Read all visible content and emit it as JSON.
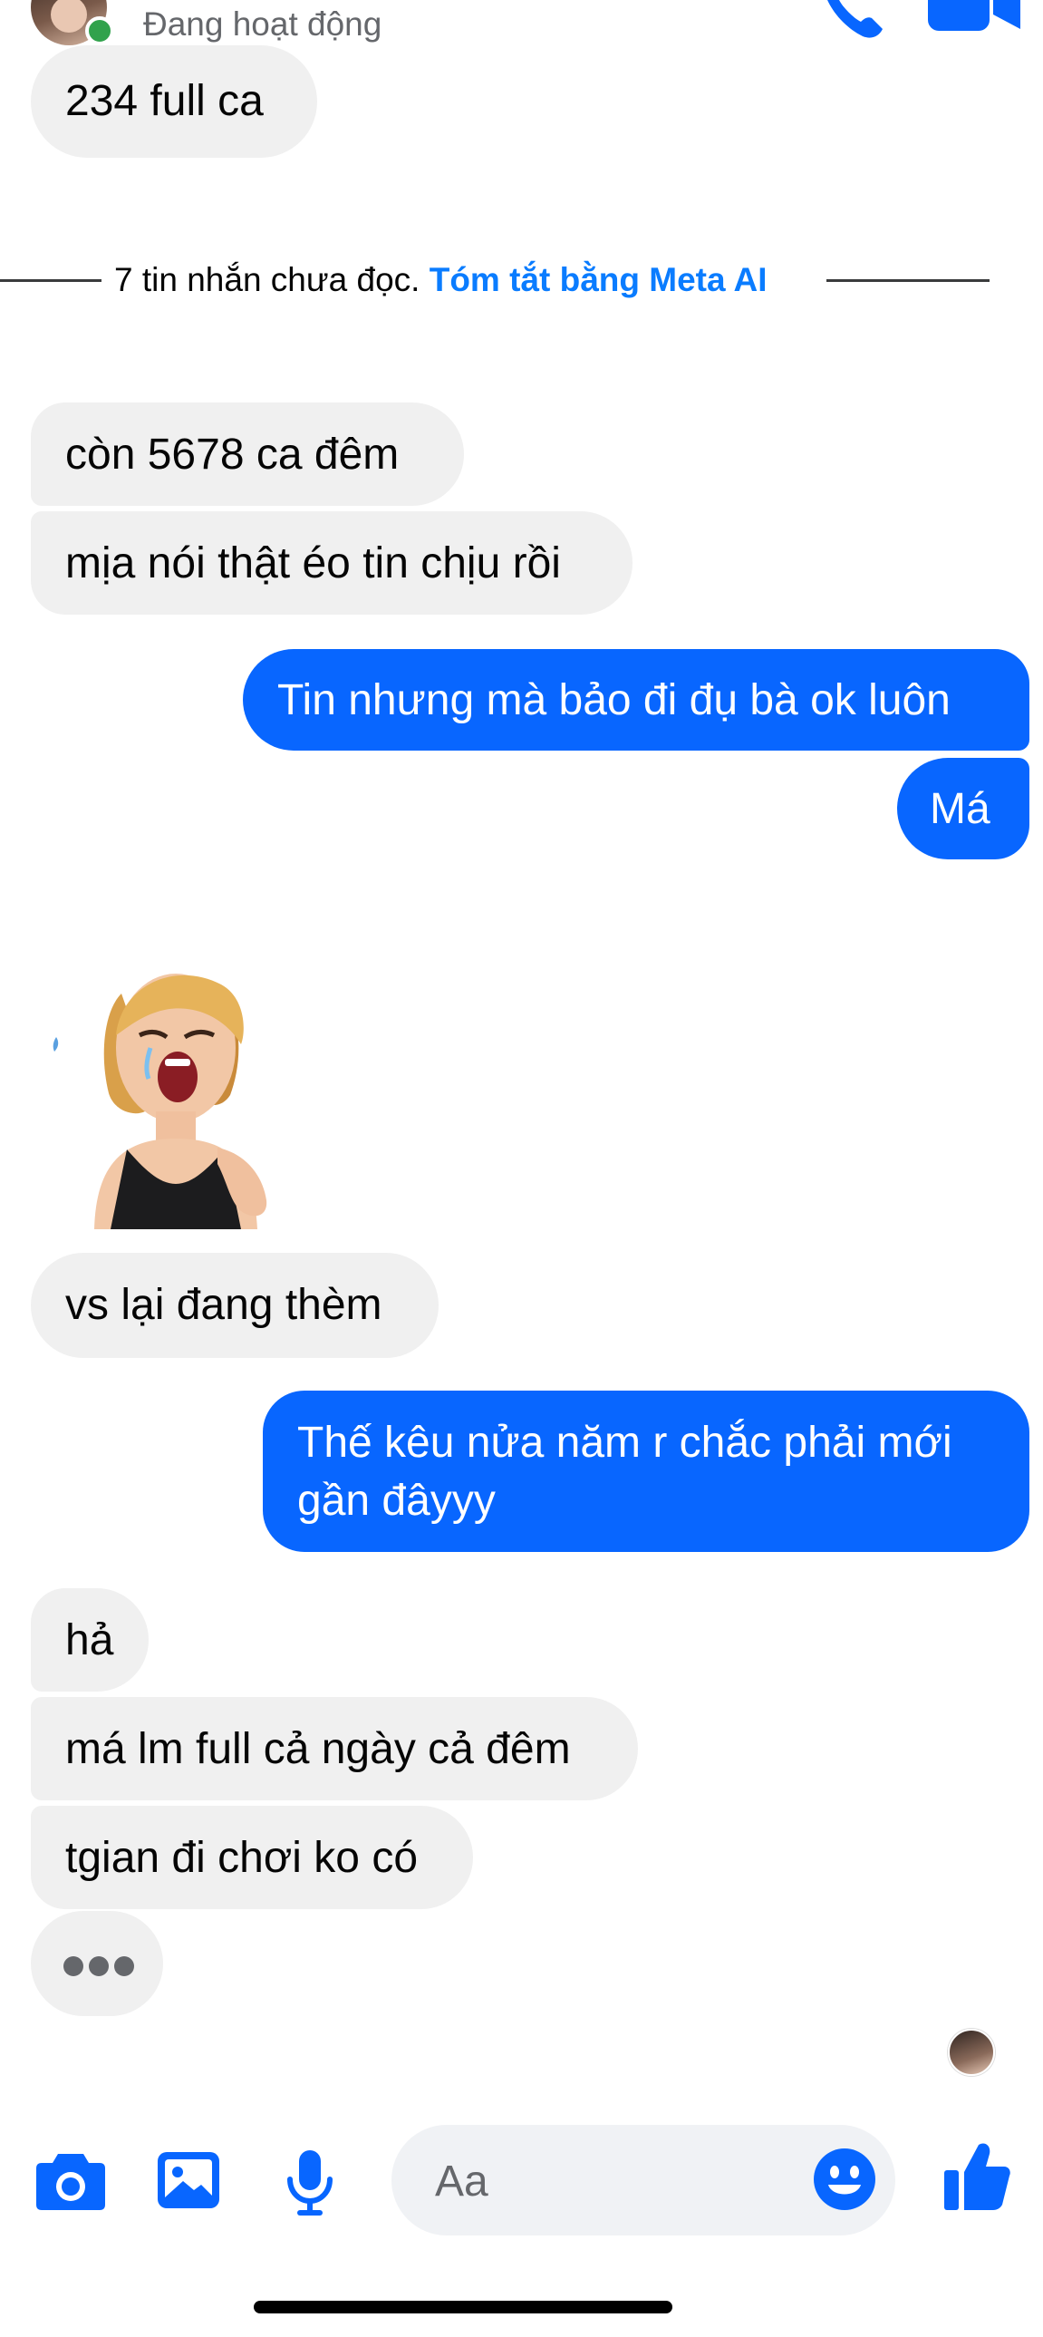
{
  "header": {
    "status": "Đang hoạt động"
  },
  "divider": {
    "unread_text": "7 tin nhắn chưa đọc.",
    "summary_link": "Tóm tắt bằng Meta AI"
  },
  "messages": [
    {
      "side": "in",
      "text": "234 full ca"
    },
    {
      "side": "in",
      "text": "còn 5678 ca đêm"
    },
    {
      "side": "in",
      "text": "mịa nói thật éo tin chịu rồi"
    },
    {
      "side": "out",
      "text": "Tin nhưng mà bảo đi đụ bà ok luôn"
    },
    {
      "side": "out",
      "text": "Má"
    },
    {
      "side": "in",
      "text": "vs lại đang thèm"
    },
    {
      "side": "out",
      "line1": "Thế kêu nửa năm r chắc phải mới",
      "line2": "gần đâyyy"
    },
    {
      "side": "in",
      "text": "hả"
    },
    {
      "side": "in",
      "text": "má lm full cả ngày cả đêm"
    },
    {
      "side": "in",
      "text": "tgian đi chơi ko có"
    }
  ],
  "sticker": {
    "icon": "crying-woman-sticker"
  },
  "typing": {
    "icon": "typing-indicator"
  },
  "composer": {
    "placeholder": "Aa",
    "icons": [
      "camera-icon",
      "gallery-icon",
      "microphone-icon",
      "emoji-icon",
      "thumbs-up-icon"
    ]
  },
  "colors": {
    "accent": "#0866ff",
    "link": "#0a7cff",
    "incoming_bubble": "#f0f0f0",
    "online": "#31a24c"
  }
}
